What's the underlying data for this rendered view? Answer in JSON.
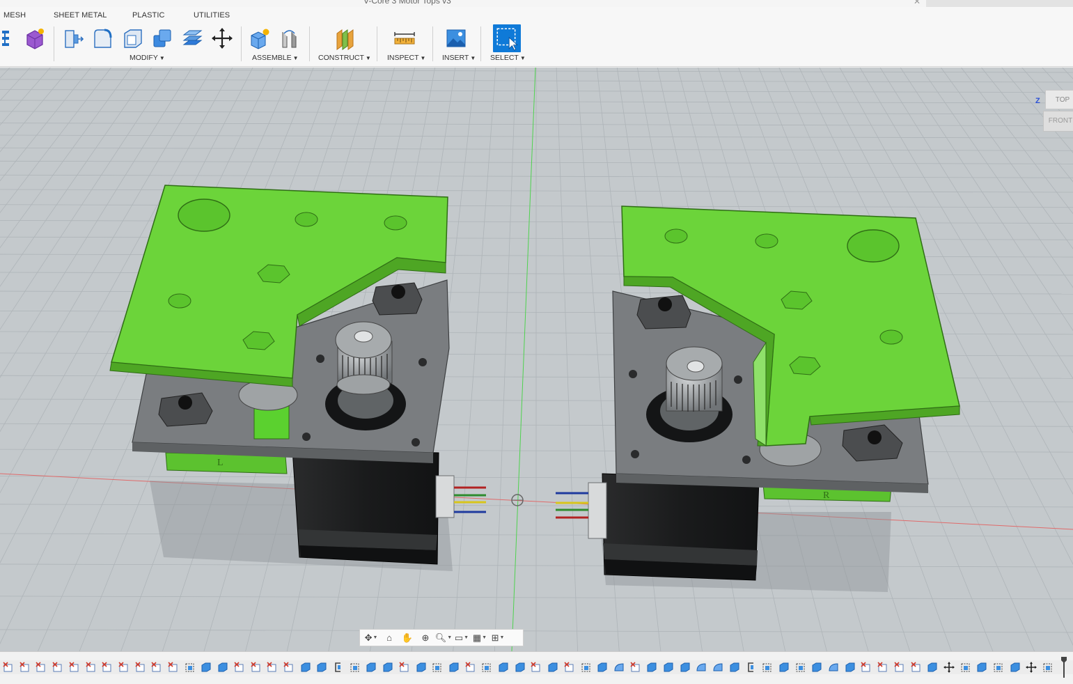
{
  "window": {
    "document_title": "V-Core 3 Motor Tops v3"
  },
  "workspace_tabs": [
    "MESH",
    "SHEET METAL",
    "PLASTIC",
    "UTILITIES"
  ],
  "toolbar_groups": {
    "modify": "MODIFY",
    "assemble": "ASSEMBLE",
    "construct": "CONSTRUCT",
    "inspect": "INSPECT",
    "insert": "INSERT",
    "select": "SELECT"
  },
  "viewcube": {
    "top": "TOP",
    "front": "FRONT",
    "axis": "Z"
  },
  "model_labels": {
    "left_part": "L",
    "right_part": "R"
  },
  "colors": {
    "part_green": "#6cd43a",
    "plate_gray": "#7a7d80",
    "motor_black": "#1e1f20",
    "grid_bg": "#c4c9cc",
    "select_blue": "#0f7ad8"
  },
  "timeline": {
    "feature_count": 64,
    "icons": [
      "sketch",
      "sketch",
      "sketch",
      "sketch",
      "sketch",
      "sketch",
      "sketch",
      "sketch",
      "sketch",
      "sketch",
      "sketch",
      "plane",
      "body",
      "body",
      "sketch",
      "sketch",
      "sketch",
      "sketch",
      "body",
      "body",
      "bracket",
      "plane",
      "body",
      "body",
      "sketch",
      "body",
      "plane",
      "body",
      "sketch",
      "plane",
      "body",
      "body",
      "sketch",
      "body",
      "sketch",
      "plane",
      "body",
      "revolve",
      "sketch",
      "body",
      "body",
      "body",
      "revolve",
      "revolve",
      "body",
      "bracket",
      "plane",
      "body",
      "plane",
      "body",
      "revolve",
      "body",
      "sketch",
      "sketch",
      "sketch",
      "sketch",
      "body",
      "move",
      "plane",
      "body",
      "plane",
      "body",
      "move",
      "plane"
    ]
  }
}
